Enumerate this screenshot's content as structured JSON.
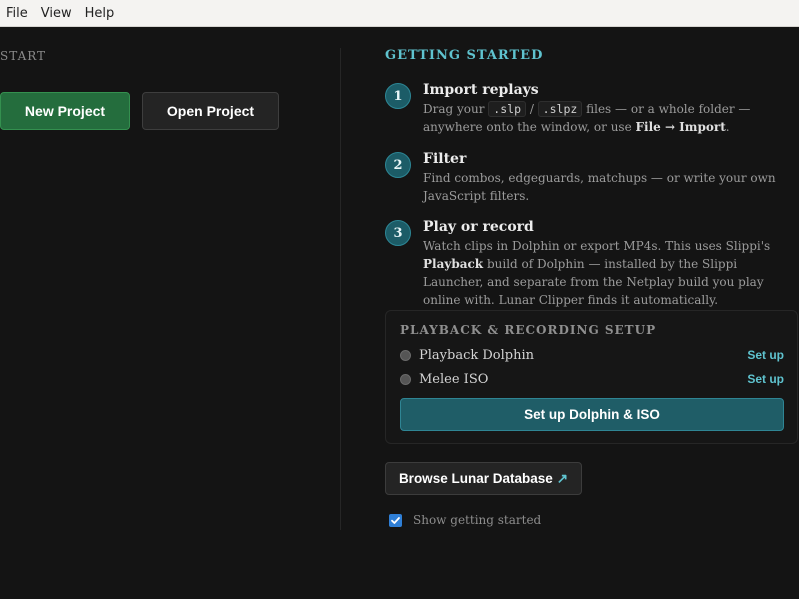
{
  "menu": [
    "File",
    "View",
    "Help"
  ],
  "start": {
    "label": "START",
    "new_project": "New Project",
    "open_project": "Open Project"
  },
  "getting_started": {
    "title": "GETTING STARTED",
    "steps": [
      {
        "num": "1",
        "title": "Import replays",
        "desc_parts": [
          "Drag your ",
          ".slp",
          " / ",
          ".slpz",
          " files — or a whole folder — anywhere onto the window, or use ",
          "File → Import",
          "."
        ]
      },
      {
        "num": "2",
        "title": "Filter",
        "desc": "Find combos, edgeguards, matchups — or write your own JavaScript filters."
      },
      {
        "num": "3",
        "title": "Play or record",
        "desc_parts": [
          "Watch clips in Dolphin or export MP4s. This uses Slippi's ",
          "Playback",
          " build of Dolphin — installed by the Slippi Launcher, and separate from the Netplay build you play online with. Lunar Clipper finds it automatically."
        ]
      }
    ]
  },
  "setup": {
    "title": "PLAYBACK & RECORDING SETUP",
    "rows": [
      {
        "label": "Playback Dolphin",
        "action": "Set up"
      },
      {
        "label": "Melee ISO",
        "action": "Set up"
      }
    ],
    "button": "Set up Dolphin & ISO"
  },
  "browse": {
    "label": "Browse Lunar Database",
    "arrow": "↗"
  },
  "show_getting_started": {
    "label": "Show getting started",
    "checked": true
  },
  "colors": {
    "accent": "#5fc3cf",
    "primary_green": "#246d3d",
    "teal_button": "#1f5d67",
    "checkbox": "#2f7fd6"
  }
}
